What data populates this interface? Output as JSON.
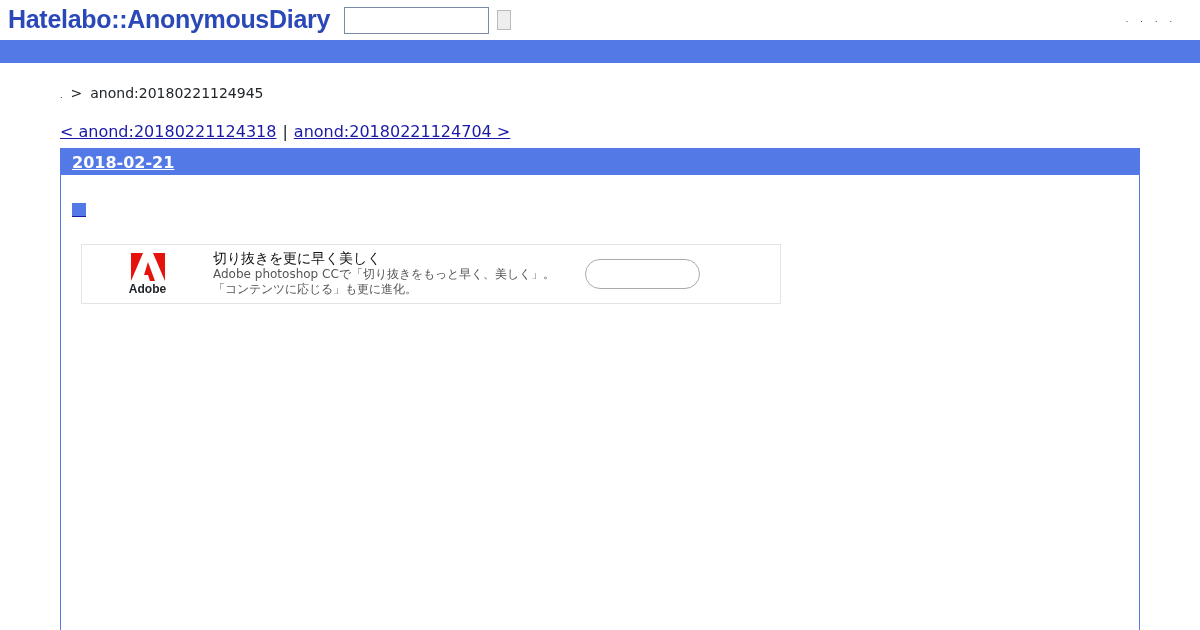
{
  "header": {
    "logo": "Hatelabo::AnonymousDiary",
    "menu_links": [
      ".",
      ".",
      ".",
      "."
    ]
  },
  "breadcrumb": {
    "home": ".",
    "separator": ">",
    "current": "anond:20180221124945"
  },
  "pager": {
    "prev": "< anond:20180221124318",
    "divider": "|",
    "next": "anond:20180221124704 >"
  },
  "day": {
    "date": "2018-02-21",
    "ad": {
      "brand": "Adobe",
      "title": "切り抜きを更に早く美しく",
      "description": "Adobe photoshop CCで「切り抜きをもっと早く、美しく」。「コンテンツに応じる」も更に進化。"
    }
  }
}
